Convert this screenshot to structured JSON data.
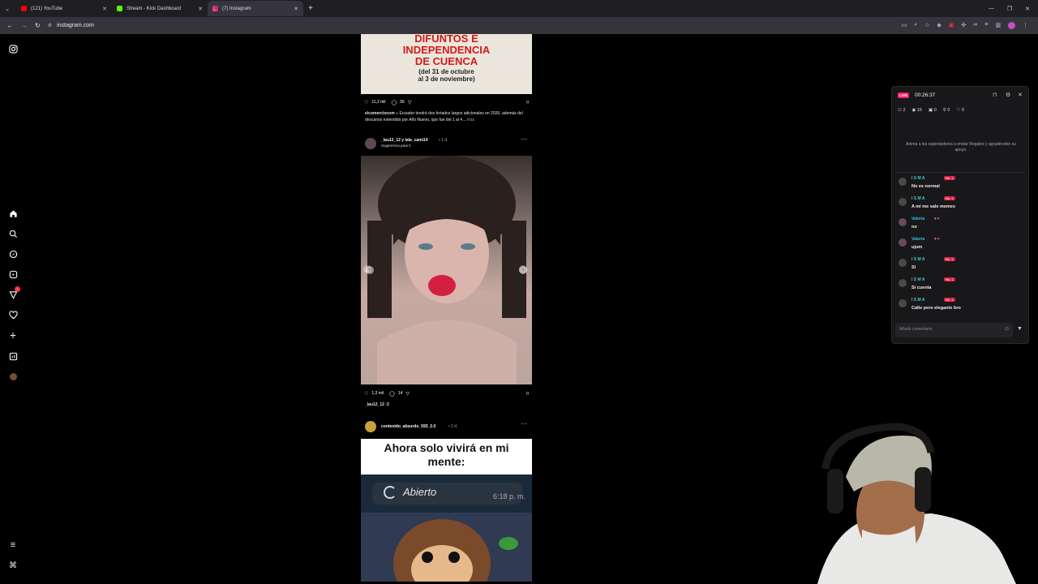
{
  "browser": {
    "tabs": [
      {
        "label": "(121) YouTube",
        "color": "#ff0000"
      },
      {
        "label": "Stream - Kick Dashboard",
        "color": "#53fc18"
      },
      {
        "label": "(7) Instagram",
        "color": "#e1306c"
      }
    ],
    "url": "instagram.com"
  },
  "leftnav": {
    "badge": "7"
  },
  "feed": {
    "post1": {
      "headline": [
        "DIFUNTOS E",
        "INDEPENDENCIA",
        "DE CUENCA"
      ],
      "dates": [
        "(del 31 de octubre",
        "al 3 de noviembre)"
      ],
      "likes": "11,2 mil",
      "comments": "56",
      "username": "elcomerciocom",
      "caption": "Ecuador tendrá dos feriados largos adicionales en 2026, además del descanso extendido por Año Nuevo, que fue del 1 al 4...",
      "more": "más"
    },
    "post2": {
      "username": "_lau12_12 y lala_cami14",
      "time": "• 1 d",
      "subtitle": "Sugerencia para ti",
      "likes": "1,3 mil",
      "comments": "14",
      "caption": "_lau12_12 :3"
    },
    "post3": {
      "username": "contenido_absurdo_593_2.0",
      "time": "• 1 d",
      "meme_text": "Ahora solo vivirá en mi mente:",
      "status": "Abierto",
      "clock": "6:18 p. m."
    }
  },
  "kick": {
    "live": "LIVE",
    "timer": "00:26:37",
    "stats": {
      "viewers_icon_count": "2",
      "views": "15",
      "gifts": "0",
      "follows": "0",
      "likes": "0"
    },
    "prompt": "Anima a los espectadores a enviar Regalos y agradéceles su apoyo.",
    "messages": [
      {
        "name": "I S M A",
        "badge": "No. 1",
        "text": "No es normal"
      },
      {
        "name": "I S M A",
        "badge": "No. 1",
        "text": "A mí me sale memes"
      },
      {
        "name": "Valeria",
        "badge": "",
        "text": "no"
      },
      {
        "name": "Valeria",
        "badge": "",
        "text": "ujum"
      },
      {
        "name": "I S M A",
        "badge": "No. 1",
        "text": "Si"
      },
      {
        "name": "I S M A",
        "badge": "No. 1",
        "text": "Si cuenta"
      },
      {
        "name": "I S M A",
        "badge": "No. 1",
        "text": "Calle pero elegante bro"
      }
    ],
    "input_placeholder": "Añadir comentario"
  }
}
